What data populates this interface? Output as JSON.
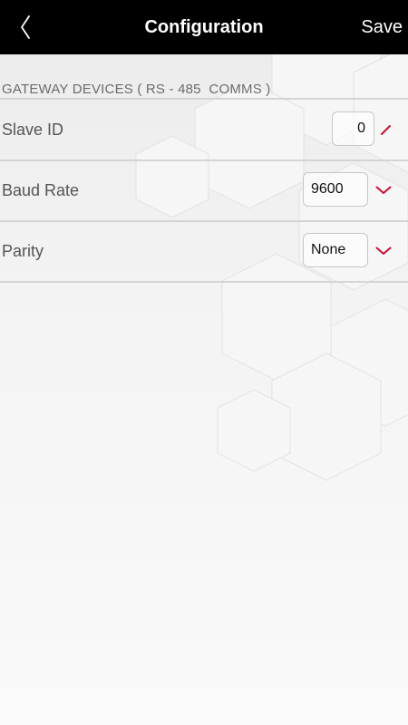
{
  "nav": {
    "title": "Configuration",
    "save_label": "Save",
    "back_icon": "chevron-left-icon"
  },
  "section": {
    "header": "GATEWAY DEVICES ( RS - 485  COMMS )"
  },
  "rows": [
    {
      "label": "Slave ID",
      "value": "0",
      "control": "text-input",
      "icon": "pencil-icon"
    },
    {
      "label": "Baud Rate",
      "value": "9600",
      "control": "dropdown",
      "icon": "chevron-down-icon"
    },
    {
      "label": "Parity",
      "value": "None",
      "control": "dropdown",
      "icon": "chevron-down-icon"
    }
  ],
  "colors": {
    "nav_background": "#000000",
    "nav_text": "#ffffff",
    "accent": "#c8102e",
    "label_text": "#555555",
    "divider": "#d4d4d4"
  }
}
